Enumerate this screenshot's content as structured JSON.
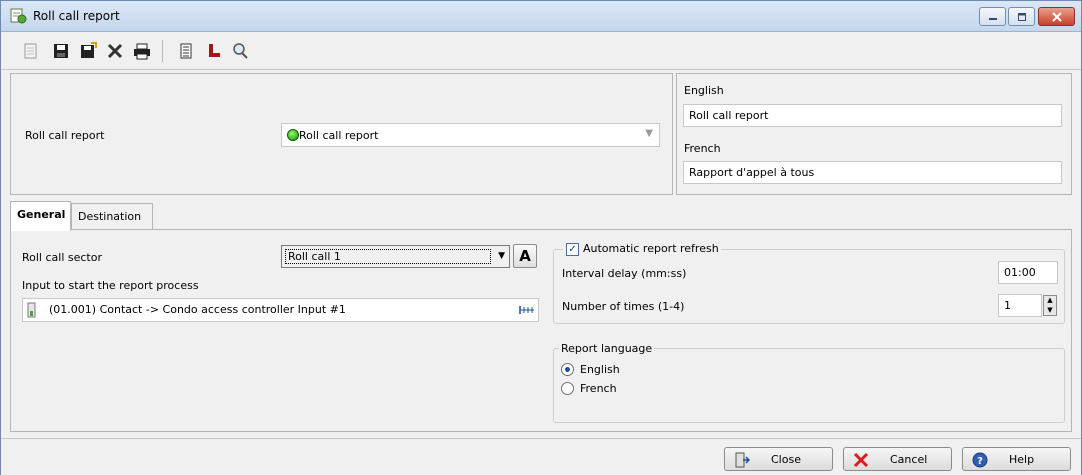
{
  "window": {
    "title": "Roll call report",
    "controls": [
      "minimize",
      "maximize",
      "close"
    ]
  },
  "toolbar": {
    "buttons": [
      {
        "name": "new-icon"
      },
      {
        "name": "save-icon"
      },
      {
        "name": "save-and-new-icon"
      },
      {
        "name": "delete-icon"
      },
      {
        "name": "print-icon"
      },
      {
        "name": "list-icon"
      },
      {
        "name": "link-icon"
      },
      {
        "name": "search-icon"
      }
    ]
  },
  "header": {
    "label": "Roll call report",
    "combo_value": "Roll call report",
    "languages": [
      {
        "label": "English",
        "value": "Roll call report"
      },
      {
        "label": "French",
        "value": "Rapport d'appel à tous"
      }
    ]
  },
  "tabs": [
    {
      "label": "General",
      "active": true
    },
    {
      "label": "Destination",
      "active": false
    }
  ],
  "general": {
    "sector_label": "Roll call sector",
    "sector_value": "Roll call 1",
    "font_button": "A",
    "input_label": "Input to start the report process",
    "input_value": "(01.001) Contact -> Condo access controller Input #1",
    "auto_refresh": {
      "label": "Automatic report refresh",
      "checked": true,
      "interval_label": "Interval delay (mm:ss)",
      "interval_value": "01:00",
      "times_label": "Number of times (1-4)",
      "times_value": "1"
    },
    "report_language": {
      "title": "Report language",
      "options": [
        {
          "label": "English",
          "selected": true
        },
        {
          "label": "French",
          "selected": false
        }
      ]
    }
  },
  "footer": {
    "close_label": "Close",
    "cancel_label": "Cancel",
    "help_label": "Help"
  },
  "colors": {
    "titlebar": "#c5d7ee",
    "close_button": "#c7402a",
    "status_dot": "#188f11",
    "cancel_x": "#d61c1c"
  }
}
